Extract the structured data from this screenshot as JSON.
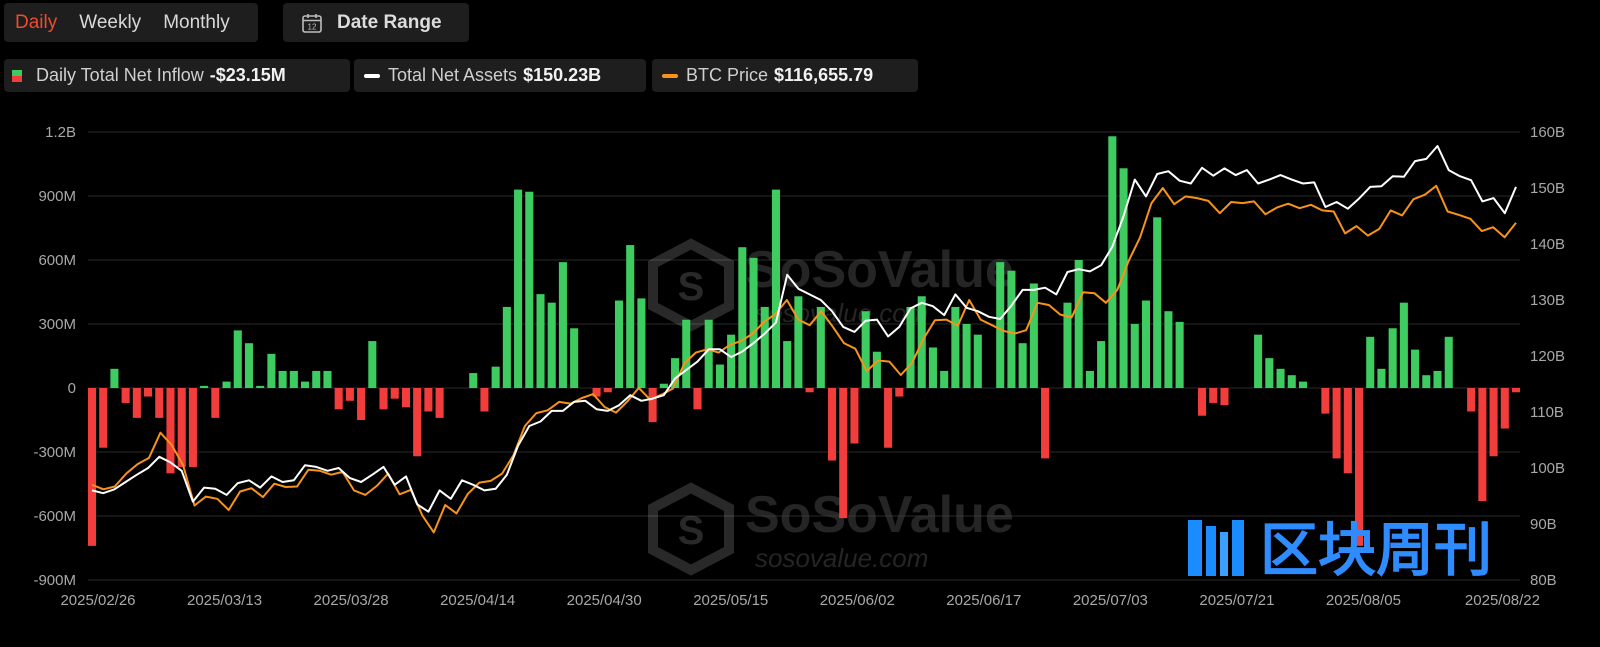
{
  "tabs": [
    {
      "label": "Daily",
      "active": true
    },
    {
      "label": "Weekly",
      "active": false
    },
    {
      "label": "Monthly",
      "active": false
    }
  ],
  "date_range": {
    "label": "Date Range",
    "icon": "calendar-icon",
    "icon_text": "12"
  },
  "legend": {
    "inflow": {
      "label": "Daily Total Net Inflow",
      "value": "-$23.15M"
    },
    "assets": {
      "label": "Total Net Assets",
      "value": "$150.23B"
    },
    "price": {
      "label": "BTC Price",
      "value": "$116,655.79"
    }
  },
  "colors": {
    "positive_bar": "#3ecb5f",
    "negative_bar": "#f23d3d",
    "assets_line": "#ffffff",
    "price_line": "#f7931a",
    "active_tab": "#f04a2e"
  },
  "watermarks": {
    "brand": "SoSoValue",
    "domain": "sosovalue.com",
    "cn_brand": "区块周刊"
  },
  "chart_data": {
    "type": "bar",
    "grid": true,
    "x_ticks": [
      "2025/02/26",
      "2025/03/13",
      "2025/03/28",
      "2025/04/14",
      "2025/04/30",
      "2025/05/15",
      "2025/06/02",
      "2025/06/17",
      "2025/07/03",
      "2025/07/21",
      "2025/08/05",
      "2025/08/22"
    ],
    "y_left": {
      "ticks": [
        "1.2B",
        "900M",
        "600M",
        "300M",
        "0",
        "-300M",
        "-600M",
        "-900M"
      ],
      "values": [
        1200,
        900,
        600,
        300,
        0,
        -300,
        -600,
        -900
      ],
      "unit": "M USD",
      "range": [
        -900,
        1200
      ]
    },
    "y_right": {
      "ticks": [
        "160B",
        "150B",
        "140B",
        "130B",
        "120B",
        "110B",
        "100B",
        "90B",
        "80B"
      ],
      "values": [
        160,
        150,
        140,
        130,
        120,
        110,
        100,
        90,
        80
      ],
      "unit": "B USD",
      "range": [
        80,
        160
      ]
    },
    "series": [
      {
        "name": "Daily Total Net Inflow",
        "kind": "bar",
        "unit": "M USD",
        "values": [
          -740,
          -280,
          90,
          -70,
          -140,
          -40,
          -140,
          -400,
          -370,
          -370,
          10,
          -140,
          30,
          270,
          210,
          10,
          160,
          80,
          80,
          30,
          80,
          80,
          -100,
          -60,
          -150,
          220,
          -100,
          -50,
          -90,
          -320,
          -110,
          -140,
          0,
          0,
          70,
          -110,
          100,
          380,
          930,
          920,
          440,
          400,
          590,
          280,
          0,
          -40,
          -20,
          410,
          670,
          420,
          -160,
          20,
          140,
          320,
          -100,
          320,
          110,
          250,
          660,
          610,
          380,
          930,
          220,
          430,
          -20,
          380,
          -340,
          -610,
          -260,
          360,
          170,
          -280,
          -40,
          380,
          430,
          190,
          80,
          380,
          300,
          250,
          0,
          590,
          550,
          210,
          490,
          -330,
          0,
          400,
          600,
          80,
          220,
          1180,
          1030,
          300,
          410,
          800,
          360,
          310,
          0,
          -130,
          -70,
          -80,
          0,
          0,
          250,
          140,
          90,
          60,
          30,
          0,
          -120,
          -330,
          -400,
          -740,
          240,
          90,
          280,
          400,
          180,
          60,
          80,
          240,
          0,
          -110,
          -530,
          -320,
          -190,
          -20
        ]
      },
      {
        "name": "Total Net Assets",
        "kind": "line",
        "unit": "B USD",
        "values": [
          96,
          95.5,
          96.2,
          97.5,
          98.8,
          100,
          102,
          101,
          99.5,
          94,
          96.5,
          96.3,
          95.2,
          97.3,
          97.8,
          96.5,
          98.5,
          97.5,
          97.8,
          100.5,
          100.2,
          99.5,
          100,
          98.2,
          97.5,
          98.8,
          100.2,
          97,
          98.5,
          93.5,
          92.2,
          96,
          94.5,
          97.8,
          97,
          96,
          96.3,
          98.8,
          104,
          107.5,
          108.3,
          110.2,
          110.2,
          111.8,
          112,
          110.5,
          110.2,
          111.2,
          113,
          112,
          112.4,
          113,
          116,
          117.5,
          119,
          121.2,
          121.2,
          119.8,
          120.8,
          122.3,
          124,
          126,
          134.5,
          132,
          131,
          130,
          128,
          125.2,
          124.3,
          126.3,
          126.5,
          123.5,
          125.2,
          128.5,
          129.5,
          128.9,
          127.3,
          131,
          128.6,
          128,
          127,
          126.6,
          129,
          131.8,
          131.8,
          132.2,
          131,
          135,
          135.5,
          135.1,
          136.2,
          139.5,
          145,
          151.5,
          148.5,
          152.5,
          153,
          151.3,
          150.8,
          153.6,
          152.2,
          153.5,
          152.3,
          153.2,
          150.8,
          151.5,
          152.3,
          151.5,
          150.8,
          151,
          146.6,
          147.5,
          146.3,
          148.1,
          150.2,
          150.3,
          152.1,
          152,
          154.8,
          155.2,
          157.5,
          153.2,
          152.1,
          151.4,
          147.6,
          148.2,
          145.5,
          150.2
        ]
      },
      {
        "name": "BTC Price",
        "kind": "line",
        "unit": "USD",
        "values": [
          84500,
          83700,
          84200,
          86500,
          88200,
          89300,
          93800,
          91600,
          88000,
          80800,
          82400,
          82000,
          80000,
          83300,
          83900,
          82300,
          84700,
          84100,
          84200,
          87200,
          87000,
          86300,
          86800,
          83500,
          82700,
          84300,
          86500,
          82800,
          83600,
          79000,
          76000,
          80900,
          79400,
          82900,
          84900,
          85200,
          86500,
          89800,
          95000,
          97300,
          97800,
          99300,
          99000,
          100000,
          100700,
          98400,
          97400,
          99400,
          101800,
          99700,
          100600,
          101700,
          106200,
          108100,
          108700,
          108100,
          109500,
          110200,
          111500,
          113600,
          115000,
          117500,
          114000,
          113000,
          115500,
          112800,
          109800,
          108800,
          104800,
          106700,
          106500,
          104100,
          106300,
          110600,
          113900,
          114000,
          112900,
          117500,
          114000,
          113000,
          112000,
          111500,
          112100,
          117000,
          116600,
          114900,
          114400,
          118900,
          118700,
          117000,
          119300,
          124500,
          128700,
          134800,
          137500,
          134600,
          136000,
          135700,
          135200,
          133000,
          135000,
          134800,
          135100,
          132800,
          134000,
          134700,
          133900,
          134500,
          133500,
          133300,
          129400,
          130700,
          129000,
          130200,
          133500,
          132600,
          135500,
          136300,
          137900,
          133300,
          132700,
          132000,
          129800,
          130500,
          128700,
          131300
        ]
      }
    ]
  }
}
